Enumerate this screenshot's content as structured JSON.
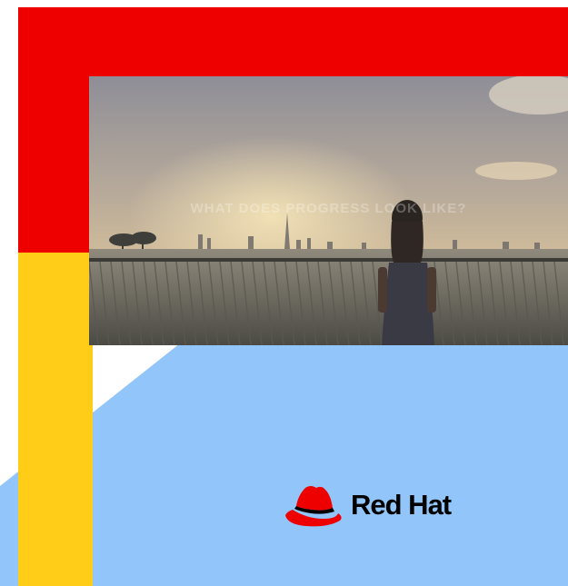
{
  "colors": {
    "red": "#ee0000",
    "yellow": "#ffcc17",
    "light_blue": "#92c5f9",
    "logo_red": "#ee0000",
    "logo_black": "#000000"
  },
  "photo": {
    "caption": "WHAT DOES PROGRESS LOOK LIKE?"
  },
  "logo": {
    "wordmark": "Red Hat",
    "icon": "red-hat-fedora-icon"
  }
}
